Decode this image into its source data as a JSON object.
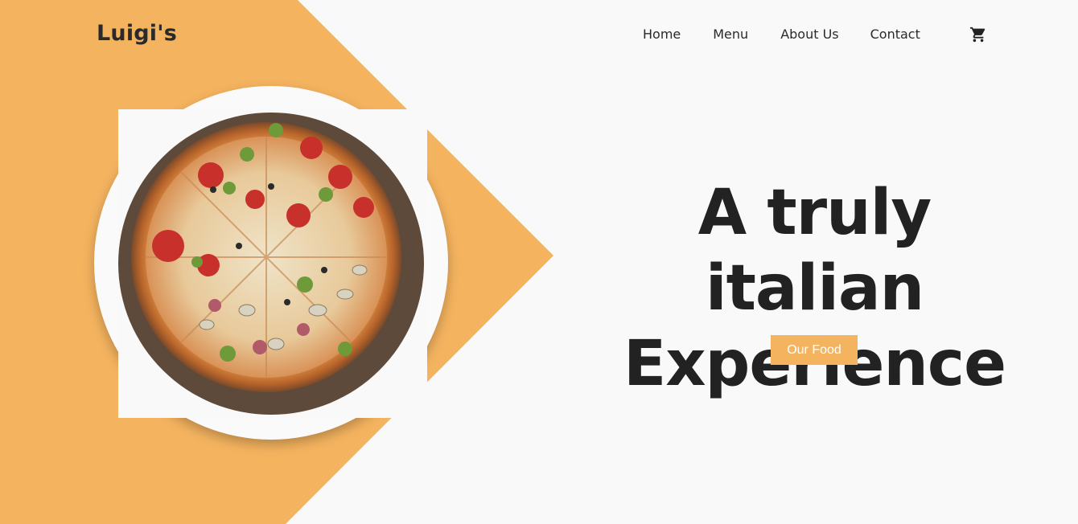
{
  "brand": {
    "name": "Luigi's"
  },
  "nav": {
    "items": [
      {
        "label": "Home"
      },
      {
        "label": "Menu"
      },
      {
        "label": "About Us"
      },
      {
        "label": "Contact"
      }
    ],
    "cart_icon": "shopping-cart-icon"
  },
  "hero": {
    "headline_line1": "A truly italian",
    "headline_line2": "Experience",
    "cta_label": "Our Food",
    "image_icon": "pizza-image"
  },
  "colors": {
    "accent": "#f4b35f",
    "background": "#f9f9f9",
    "text": "#222222",
    "plate": "#fafafa"
  }
}
